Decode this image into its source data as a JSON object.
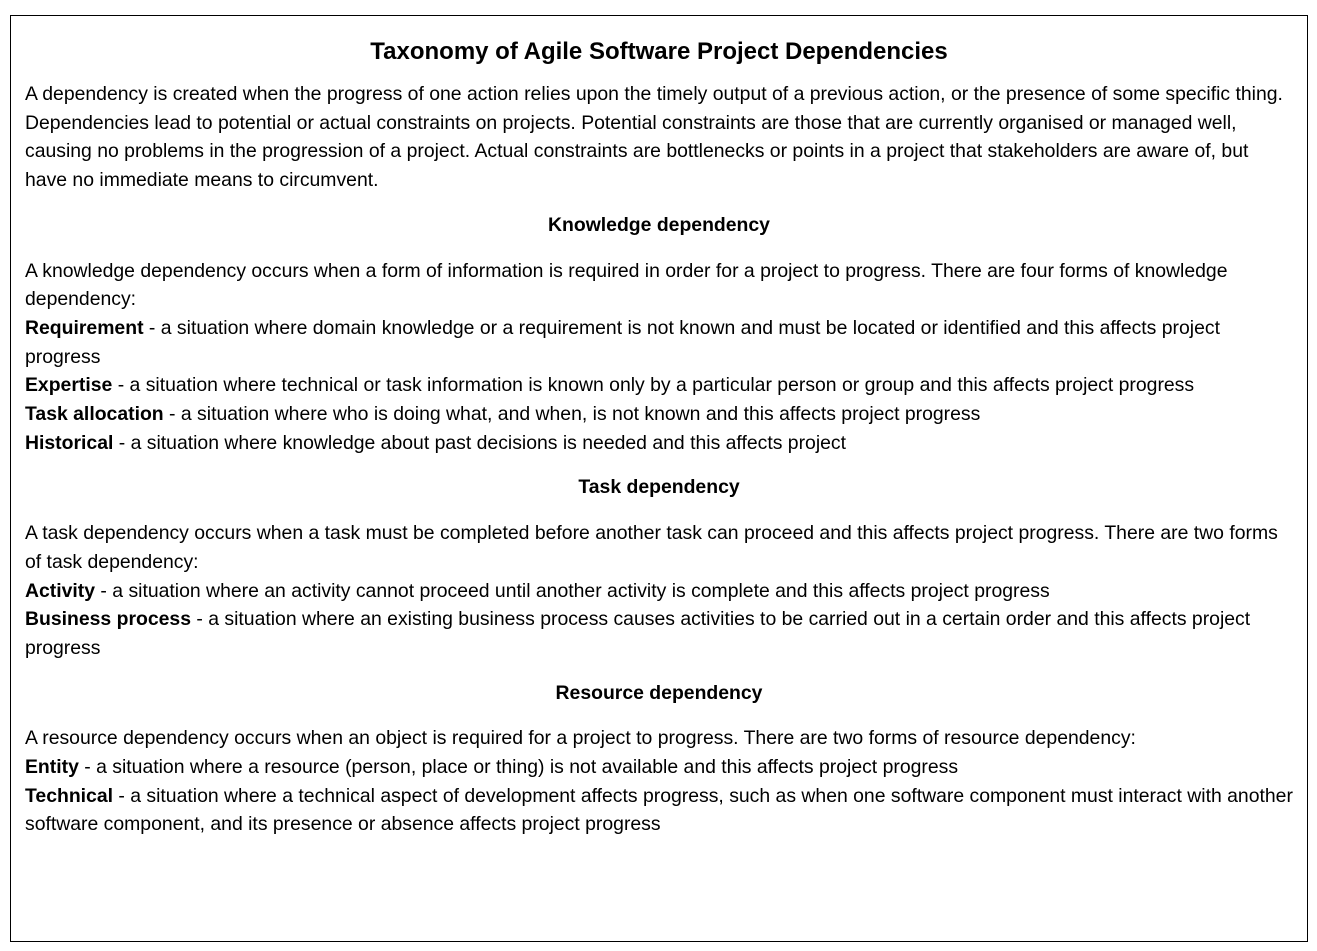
{
  "document": {
    "title": "Taxonomy of Agile Software Project Dependencies",
    "intro": "A dependency is created when the progress of one action relies upon the timely output of a previous action, or the presence of some specific thing. Dependencies lead to potential or actual constraints on projects. Potential constraints are those that are currently organised or managed well, causing no problems in the progression of a project. Actual constraints are bottlenecks or points in a project that stakeholders are aware of, but have no immediate means to circumvent.",
    "sections": [
      {
        "heading": "Knowledge dependency",
        "description": "A knowledge dependency occurs when a form of information is required in order for a project to progress. There are four forms of knowledge dependency:",
        "items": [
          {
            "term": "Requirement",
            "definition": " - a situation where domain knowledge or a requirement is not known and must be located or identified and this affects project progress"
          },
          {
            "term": "Expertise",
            "definition": " - a situation where technical or task information is known only by a particular person or group and this affects project progress"
          },
          {
            "term": "Task allocation",
            "definition": " - a situation where who is doing what, and when, is not known and this affects project progress"
          },
          {
            "term": "Historical",
            "definition": " - a situation where knowledge about past decisions is needed and this affects project"
          }
        ]
      },
      {
        "heading": "Task dependency",
        "description": "A task dependency occurs when a task must be completed before another task can proceed and this affects project progress. There are two forms of task dependency:",
        "items": [
          {
            "term": "Activity",
            "definition": " - a situation where an activity cannot proceed until another activity is complete and this affects project progress"
          },
          {
            "term": "Business process",
            "definition": " - a situation where an existing business process causes activities to be carried out in a certain order and this affects project progress"
          }
        ]
      },
      {
        "heading": "Resource dependency",
        "description": "A resource dependency occurs when an object is required for a project to progress. There are two forms of resource dependency:",
        "items": [
          {
            "term": "Entity",
            "definition": " - a situation where a resource (person, place or thing) is not available and this affects project progress"
          },
          {
            "term": "Technical",
            "definition": " - a situation where a technical aspect of development affects progress, such as when one software component must interact with another software component, and its presence or absence affects project progress"
          }
        ]
      }
    ]
  }
}
